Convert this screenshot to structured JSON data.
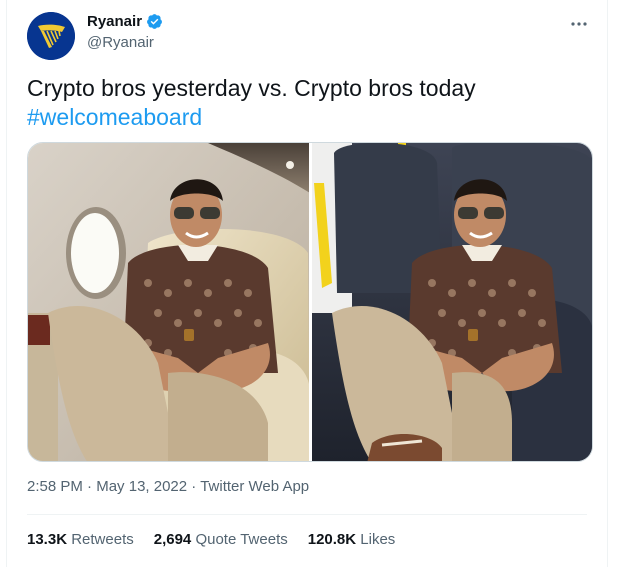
{
  "author": {
    "name": "Ryanair",
    "handle": "@Ryanair",
    "brand_color": "#073590",
    "accent_color": "#f1c933"
  },
  "tweet": {
    "text": "Crypto bros yesterday vs. Crypto bros today",
    "hashtag": "#welcomeaboard"
  },
  "media": {
    "left_photo": "man-in-private-jet-seat",
    "right_photo": "man-in-economy-seat"
  },
  "meta": {
    "time": "2:58 PM",
    "date": "May 13, 2022",
    "source": "Twitter Web App",
    "separator": "·"
  },
  "stats": [
    {
      "count": "13.3K",
      "label": "Retweets"
    },
    {
      "count": "2,694",
      "label": "Quote Tweets"
    },
    {
      "count": "120.8K",
      "label": "Likes"
    }
  ],
  "colors": {
    "link": "#1d9bf0",
    "text": "#0f1419",
    "secondary": "#536471",
    "border": "#eff3f4"
  }
}
